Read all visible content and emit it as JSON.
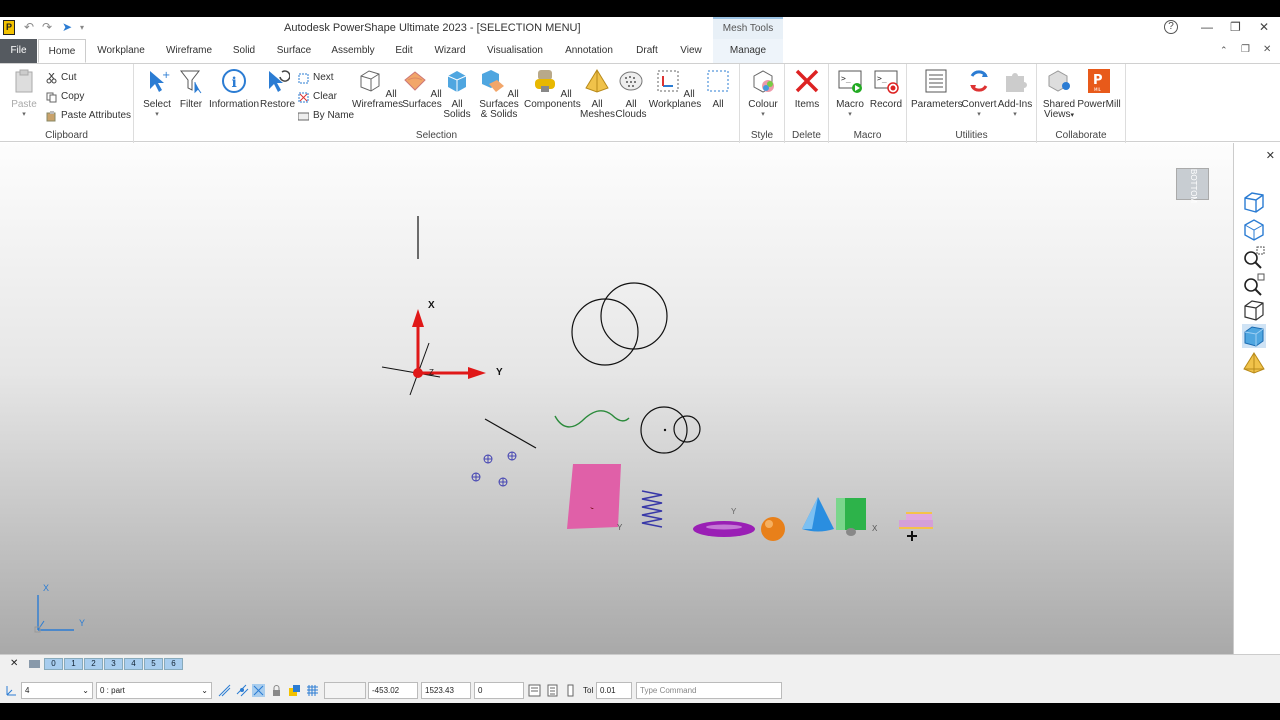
{
  "titlebar": {
    "title": "Autodesk PowerShape Ultimate 2023 - [SELECTION MENU]",
    "context_tab": "Mesh Tools",
    "help": "?",
    "minimize": "—",
    "restore": "❐",
    "close": "✕"
  },
  "tabs": [
    "File",
    "Home",
    "Workplane",
    "Wireframe",
    "Solid",
    "Surface",
    "Assembly",
    "Edit",
    "Wizard",
    "Visualisation",
    "Annotation",
    "Draft",
    "View",
    "Manage"
  ],
  "ribbon": {
    "clipboard": {
      "paste": "Paste",
      "cut": "Cut",
      "copy": "Copy",
      "paste_attributes": "Paste Attributes",
      "label": "Clipboard"
    },
    "selection": {
      "select": "Select",
      "filter": "Filter",
      "information": "Information",
      "restore": "Restore",
      "next": "Next",
      "clear": "Clear",
      "by_name": "By Name",
      "all_wireframes_1": "All",
      "all_wireframes_2": "Wireframes",
      "all_surfaces_1": "All",
      "all_surfaces_2": "Surfaces",
      "all_solids_1": "All",
      "all_solids_2": "Solids",
      "all_surfsolids_1": "All Surfaces",
      "all_surfsolids_2": "& Solids",
      "all_components_1": "All",
      "all_components_2": "Components",
      "all_meshes_1": "All",
      "all_meshes_2": "Meshes",
      "all_clouds_1": "All",
      "all_clouds_2": "Clouds",
      "all_workplanes_1": "All",
      "all_workplanes_2": "Workplanes",
      "all": "All",
      "label": "Selection"
    },
    "style": {
      "colour": "Colour",
      "label": "Style"
    },
    "delete": {
      "items": "Items",
      "label": "Delete"
    },
    "macro": {
      "macro": "Macro",
      "record": "Record",
      "label": "Macro"
    },
    "utilities": {
      "parameters": "Parameters",
      "convert": "Convert",
      "addins": "Add-Ins",
      "label": "Utilities"
    },
    "collaborate": {
      "shared_views_1": "Shared",
      "shared_views_2": "Views",
      "powermill": "PowerMill",
      "label": "Collaborate"
    }
  },
  "viewport": {
    "view_label": "BOTTOM",
    "axis_x": "X",
    "axis_y": "Y",
    "axis_z": "Z",
    "small_x": "X",
    "small_y": "Y"
  },
  "status": {
    "levels": [
      "0",
      "1",
      "2",
      "3",
      "4",
      "5",
      "6"
    ],
    "workplane_value": "4",
    "level_value": "0  : part",
    "x": "-453.02",
    "y": "1523.43",
    "z": "0",
    "tol_label": "Tol",
    "tol_value": "0.01",
    "command_placeholder": "Type Command"
  },
  "colors": {
    "accent": "#2b7cd3",
    "file_tab": "#555a60",
    "pink_surface": "#e060a8",
    "purple_torus": "#9a1fb5",
    "green_cylinder": "#2db34a",
    "blue_cone": "#2a8ee0",
    "orange_sphere": "#e8801a"
  }
}
